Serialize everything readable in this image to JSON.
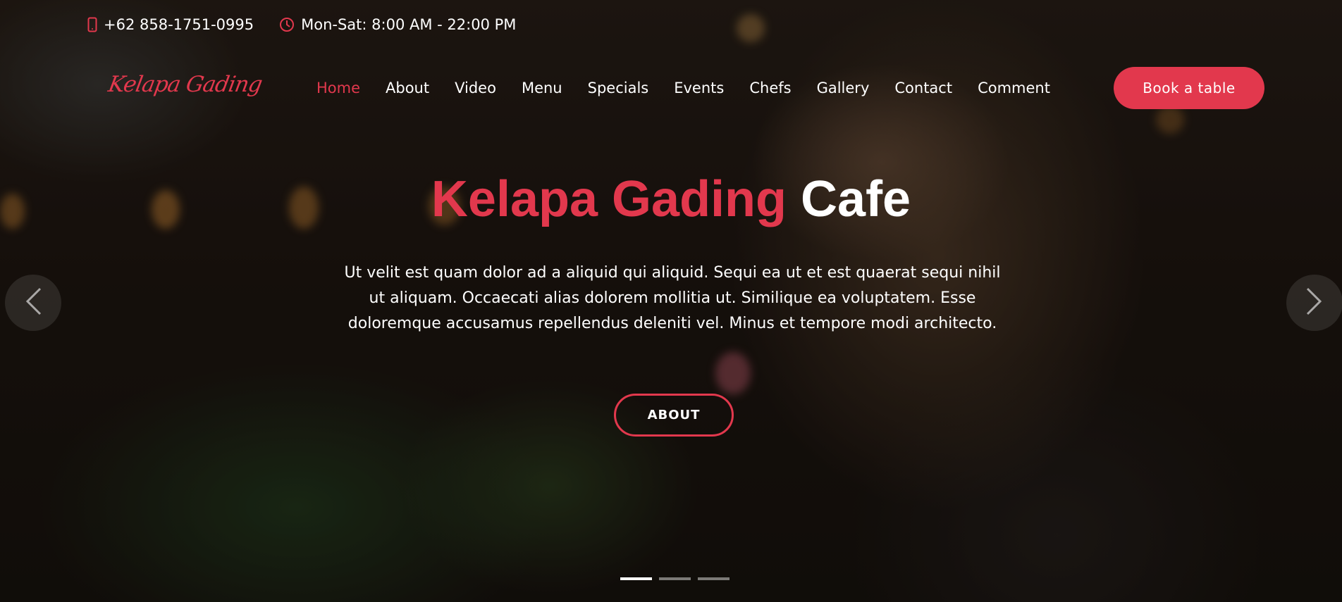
{
  "topbar": {
    "phone": "+62 858-1751-0995",
    "phone_icon": "mobile-phone-icon",
    "hours": "Mon-Sat: 8:00 AM - 22:00 PM",
    "hours_icon": "clock-icon"
  },
  "header": {
    "logo": "Kelapa Gading",
    "nav": [
      "Home",
      "About",
      "Video",
      "Menu",
      "Specials",
      "Events",
      "Chefs",
      "Gallery",
      "Contact",
      "Comment"
    ],
    "active_nav": "Home",
    "book_button": "Book a table"
  },
  "hero": {
    "title_accent": "Kelapa Gading",
    "title_rest": "Cafe",
    "description": "Ut velit est quam dolor ad a aliquid qui aliquid. Sequi ea ut et est quaerat sequi nihil ut aliquam. Occaecati alias dolorem mollitia ut. Similique ea voluptatem. Esse doloremque accusamus repellendus deleniti vel. Minus et tempore modi architecto.",
    "button": "ABOUT"
  },
  "carousel": {
    "prev_icon": "chevron-left-icon",
    "next_icon": "chevron-right-icon",
    "slide_count": 3,
    "active_slide": 1
  },
  "colors": {
    "accent": "#e2384d",
    "text": "#ffffff"
  }
}
